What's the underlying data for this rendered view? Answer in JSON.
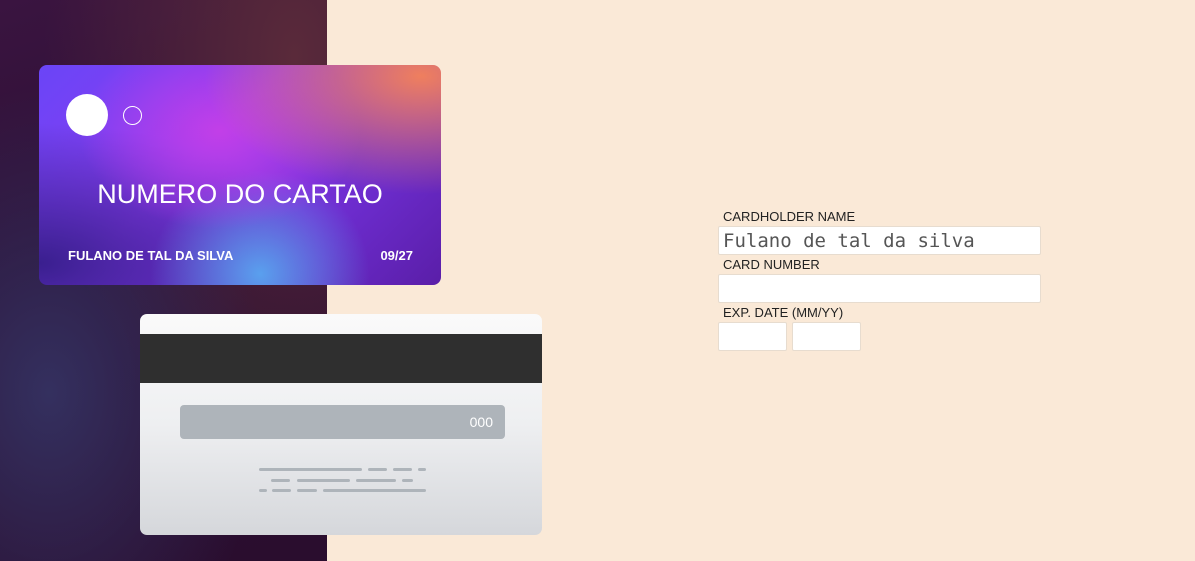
{
  "card_front": {
    "number": "NUMERO DO CARTAO",
    "holder": "FULANO DE TAL DA SILVA",
    "expiry": "09/27"
  },
  "card_back": {
    "cvv": "000"
  },
  "form": {
    "cardholder_label": "CARDHOLDER NAME",
    "cardholder_value": "Fulano de tal da silva",
    "card_number_label": "CARD NUMBER",
    "card_number_value": "",
    "exp_label": "EXP. DATE (MM/YY)",
    "exp_month_value": "",
    "exp_year_value": ""
  },
  "colors": {
    "page_background": "#fae9d7",
    "left_panel": "#2b0f33",
    "magnetic_strip": "#2f2f2f",
    "cvv_bar": "#aeb4ba"
  }
}
